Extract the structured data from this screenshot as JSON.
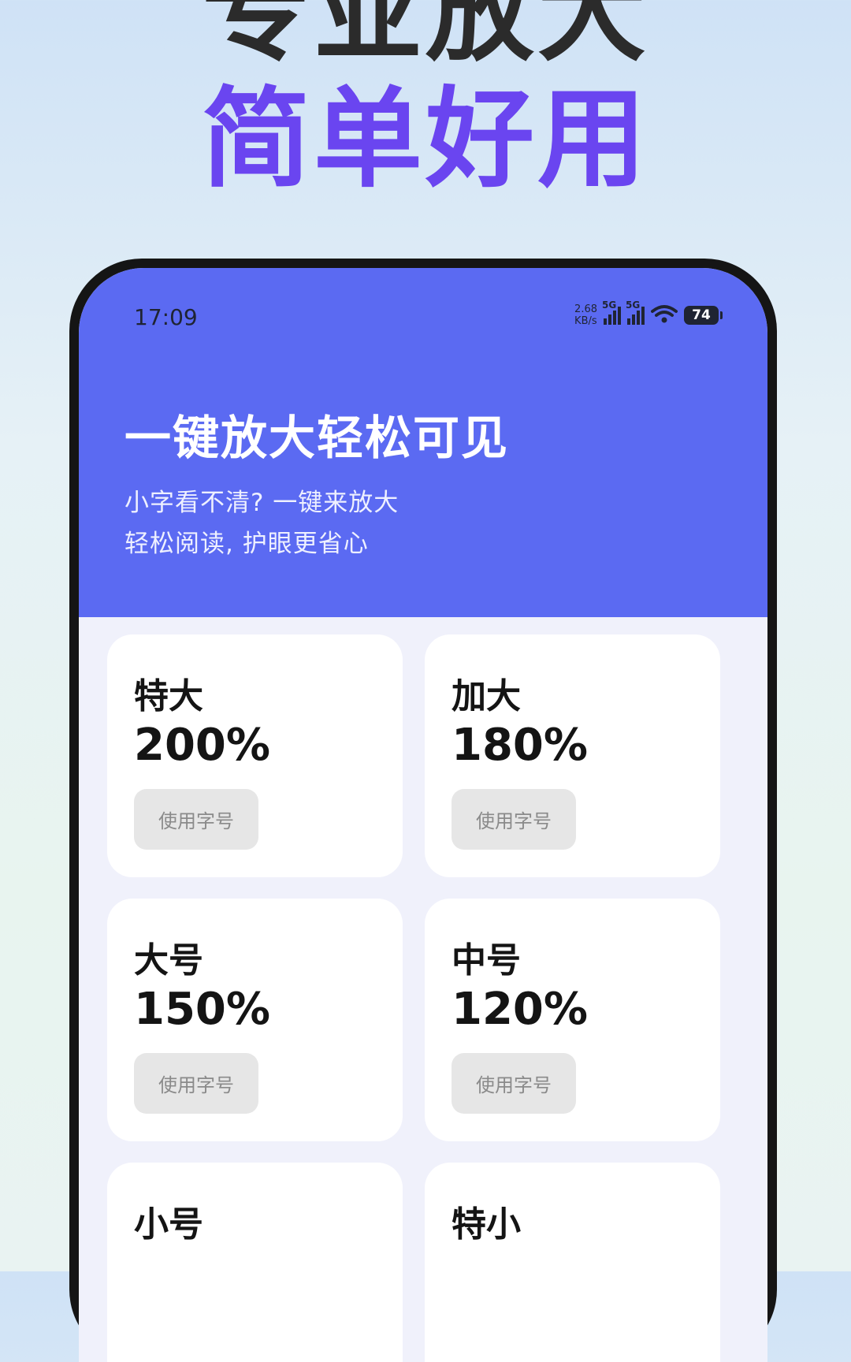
{
  "promo": {
    "line1": "专业放大",
    "line2": "简单好用"
  },
  "status_bar": {
    "time": "17:09",
    "net_speed_value": "2.68",
    "net_speed_unit": "KB/s",
    "sim1_label": "5G",
    "sim2_label": "5G",
    "battery": "74"
  },
  "header": {
    "title": "一键放大轻松可见",
    "subtitle_line1": "小字看不清? 一键来放大",
    "subtitle_line2": "轻松阅读, 护眼更省心"
  },
  "font_options": [
    {
      "label": "特大",
      "percent": "200%",
      "button": "使用字号"
    },
    {
      "label": "加大",
      "percent": "180%",
      "button": "使用字号"
    },
    {
      "label": "大号",
      "percent": "150%",
      "button": "使用字号"
    },
    {
      "label": "中号",
      "percent": "120%",
      "button": "使用字号"
    },
    {
      "label": "小号",
      "percent": "",
      "button": ""
    },
    {
      "label": "特小",
      "percent": "",
      "button": ""
    }
  ],
  "colors": {
    "accent": "#5b6af2",
    "promo_highlight": "#6a45f0",
    "background": "#f0f1fb"
  }
}
